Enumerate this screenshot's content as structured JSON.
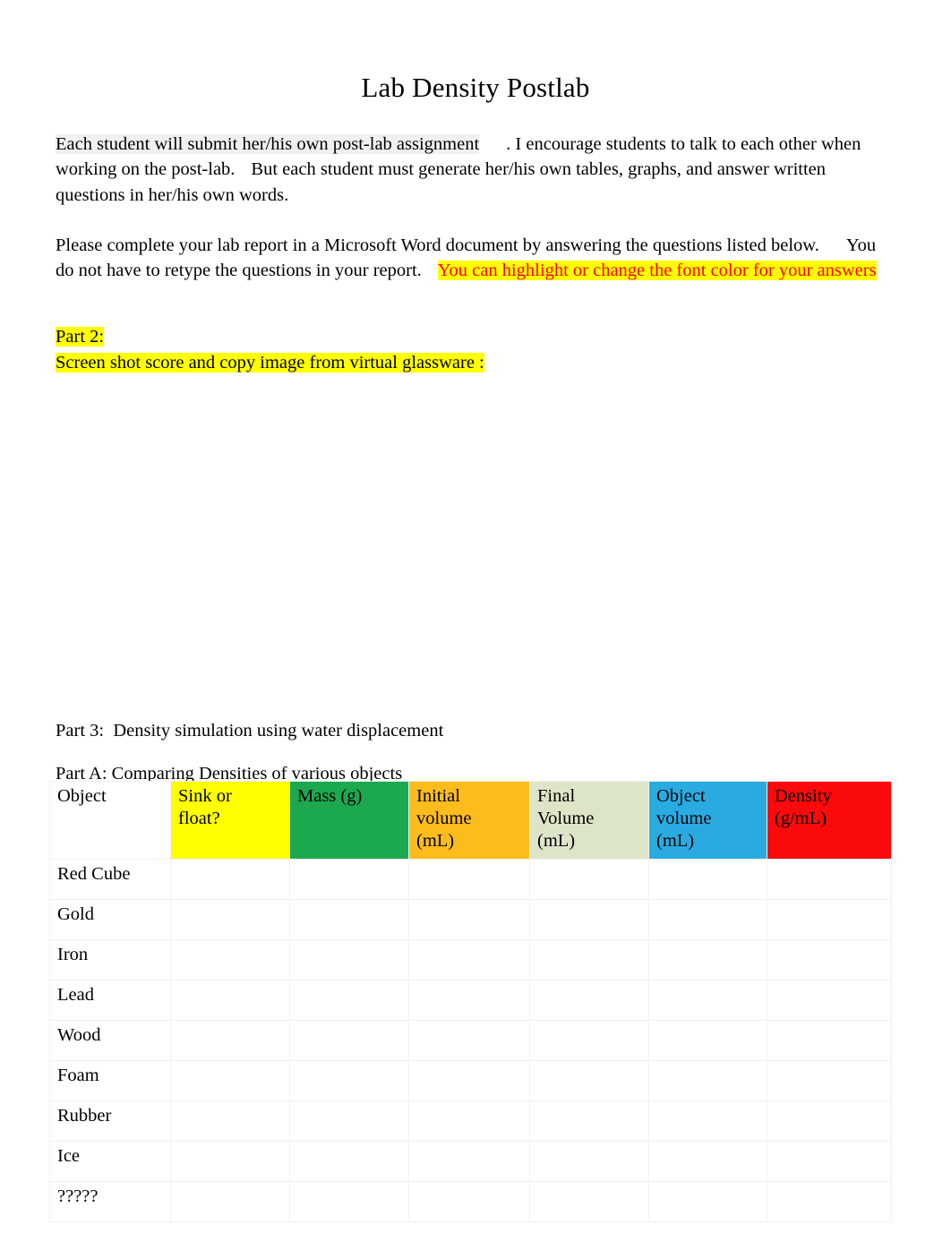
{
  "document": {
    "title": "Lab Density Postlab"
  },
  "paragraphs": {
    "intro": {
      "highlighted_lead": "Each student will submit her/his own post-lab assignment",
      "rest": ". I encourage students to talk to each other when working on the post-lab.",
      "continuation": "But each student must generate her/his own tables, graphs, and answer written questions in her/his own words."
    },
    "report": {
      "lead": "Please complete your lab report in a Microsoft Word document by answering the questions listed below.",
      "middle": "You do not have to retype the questions in your report.",
      "highlighted_red": "You can highlight or change the font color for your answers"
    }
  },
  "part2": {
    "label": "Part 2:",
    "instruction": "Screen shot score and copy image from virtual glassware :"
  },
  "part3": {
    "label": "Part 3:",
    "text": "Density simulation using water displacement"
  },
  "partA": {
    "text": "Part A: Comparing Densities of various objects"
  },
  "table": {
    "headers": [
      {
        "label": "Object",
        "color": "#ffffff",
        "fill_class": "c-white"
      },
      {
        "label": "Sink or float?",
        "color": "#ffff00",
        "fill_class": "c-yellow"
      },
      {
        "label": "Mass (g)",
        "color": "#1ca84f",
        "fill_class": "c-green"
      },
      {
        "label": "Initial volume (mL)",
        "color": "#fbbc1c",
        "fill_class": "c-orange"
      },
      {
        "label": "Final Volume (mL)",
        "color": "#dde5c8",
        "fill_class": "c-pale"
      },
      {
        "label": "Object volume (mL)",
        "color": "#29abe2",
        "fill_class": "c-blue"
      },
      {
        "label": "Density (g/mL)",
        "color": "#fa0a0a",
        "fill_class": "c-red"
      }
    ],
    "header_lines": [
      [
        "Object"
      ],
      [
        "Sink or",
        "float?"
      ],
      [
        "Mass (g)"
      ],
      [
        "Initial",
        "volume",
        "(mL)"
      ],
      [
        "Final",
        "Volume",
        "(mL)"
      ],
      [
        "Object",
        "volume",
        "(mL)"
      ],
      [
        "Density",
        "(g/mL)"
      ]
    ],
    "rows": [
      {
        "object": "Red Cube",
        "sink_or_float": "",
        "mass_g": "",
        "initial_volume_mL": "",
        "final_volume_mL": "",
        "object_volume_mL": "",
        "density_g_mL": ""
      },
      {
        "object": "Gold",
        "sink_or_float": "",
        "mass_g": "",
        "initial_volume_mL": "",
        "final_volume_mL": "",
        "object_volume_mL": "",
        "density_g_mL": ""
      },
      {
        "object": "Iron",
        "sink_or_float": "",
        "mass_g": "",
        "initial_volume_mL": "",
        "final_volume_mL": "",
        "object_volume_mL": "",
        "density_g_mL": ""
      },
      {
        "object": "Lead",
        "sink_or_float": "",
        "mass_g": "",
        "initial_volume_mL": "",
        "final_volume_mL": "",
        "object_volume_mL": "",
        "density_g_mL": ""
      },
      {
        "object": "Wood",
        "sink_or_float": "",
        "mass_g": "",
        "initial_volume_mL": "",
        "final_volume_mL": "",
        "object_volume_mL": "",
        "density_g_mL": ""
      },
      {
        "object": "Foam",
        "sink_or_float": "",
        "mass_g": "",
        "initial_volume_mL": "",
        "final_volume_mL": "",
        "object_volume_mL": "",
        "density_g_mL": ""
      },
      {
        "object": "Rubber",
        "sink_or_float": "",
        "mass_g": "",
        "initial_volume_mL": "",
        "final_volume_mL": "",
        "object_volume_mL": "",
        "density_g_mL": ""
      },
      {
        "object": "Ice",
        "sink_or_float": "",
        "mass_g": "",
        "initial_volume_mL": "",
        "final_volume_mL": "",
        "object_volume_mL": "",
        "density_g_mL": ""
      },
      {
        "object": "?????",
        "sink_or_float": "",
        "mass_g": "",
        "initial_volume_mL": "",
        "final_volume_mL": "",
        "object_volume_mL": "",
        "density_g_mL": ""
      }
    ]
  },
  "colors": {
    "highlight_yellow": "#ffff00",
    "highlight_gray": "#f0f0f0",
    "text_red": "#ff0000",
    "text_black": "#000000",
    "page_background": "#ffffff",
    "grid_line": "#f1f1f1"
  }
}
